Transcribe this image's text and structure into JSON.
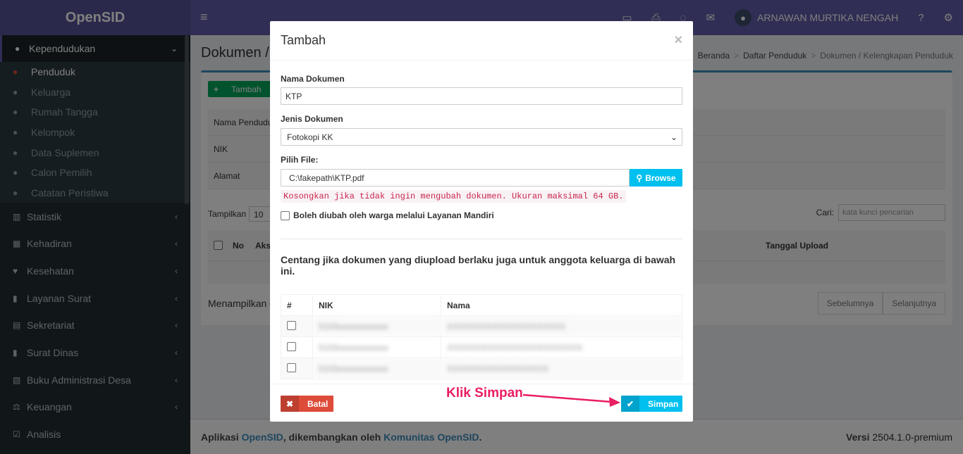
{
  "app": {
    "logo": "OpenSID",
    "user": "ARNAWAN MURTIKA NENGAH"
  },
  "sidebar": {
    "section": "Kependudukan",
    "sub_items": [
      "Penduduk",
      "Keluarga",
      "Rumah Tangga",
      "Kelompok",
      "Data Suplemen",
      "Calon Pemilih",
      "Catatan Peristiwa"
    ],
    "menu_items": [
      "Statistik",
      "Kehadiran",
      "Kesehatan",
      "Layanan Surat",
      "Sekretariat",
      "Surat Dinas",
      "Buku Administrasi Desa",
      "Keuangan",
      "Analisis"
    ]
  },
  "page": {
    "title": "Dokumen /",
    "breadcrumb": [
      "Beranda",
      "Daftar Penduduk",
      "Dokumen / Kelengkapan Penduduk"
    ],
    "add_button": "Tambah",
    "info_labels": [
      "Nama Penduduk",
      "NIK",
      "Alamat"
    ],
    "show_label": "Tampilkan",
    "show_value": "10",
    "search_label": "Cari:",
    "search_placeholder": "kata kunci pencarian",
    "table_headers": {
      "no": "No",
      "aksi": "Aksi",
      "tanggal": "Tanggal Upload"
    },
    "showing": "Menampilkan 0",
    "prev": "Sebelumnya",
    "next": "Selanjutnya"
  },
  "footer": {
    "prefix": "Aplikasi",
    "app_link": "OpenSID",
    "mid": ", dikembangkan oleh",
    "community_link": "Komunitas OpenSID",
    "version_label": "Versi",
    "version": "2504.1.0-premium"
  },
  "modal": {
    "title": "Tambah",
    "close": "×",
    "nama_label": "Nama Dokumen",
    "nama_value": "KTP",
    "jenis_label": "Jenis Dokumen",
    "jenis_value": "Fotokopi KK",
    "file_label": "Pilih File:",
    "file_value": "C:\\fakepath\\KTP.pdf",
    "browse": "Browse",
    "hint": "Kosongkan jika tidak ingin mengubah dokumen. Ukuran maksimal 64 GB.",
    "mandiri_label": "Boleh diubah oleh warga melalui Layanan Mandiri",
    "note": "Centang jika dokumen yang diupload berlaku juga untuk anggota keluarga di bawah ini.",
    "kel_headers": [
      "#",
      "NIK",
      "Nama"
    ],
    "kel_rows": [
      {
        "nik": "5103xxxxxxxxxxxx",
        "nama": "XXXXXXXXXXXXXXXXXXXXX"
      },
      {
        "nik": "5103xxxxxxxxxxxx",
        "nama": "XXXXXXXXXXXXXXXXXXXXXXXX"
      },
      {
        "nik": "5103xxxxxxxxxxxx",
        "nama": "XXXXXXXXXXXXXXXXXX"
      }
    ],
    "batal": "Batal",
    "simpan": "Simpan"
  },
  "annotation": "Klik Simpan",
  "colors": {
    "header": "#605ca8",
    "sidebar": "#222d32",
    "success": "#00a65a",
    "info": "#00c0ef",
    "danger": "#dd4b39",
    "annotation": "#e91e63"
  }
}
